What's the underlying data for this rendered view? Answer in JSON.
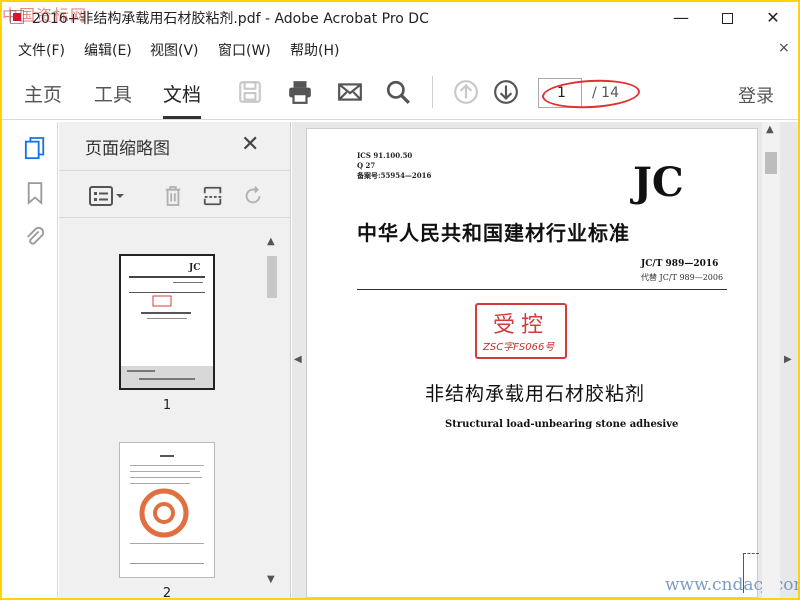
{
  "window": {
    "title": "2016+非结构承载用石材胶粘剂.pdf - Adobe Acrobat Pro DC",
    "min_glyph": "—",
    "close_glyph": "✕"
  },
  "watermark": {
    "top_left": "中国资标网",
    "bottom_right": "www.cndacj.com"
  },
  "menu": {
    "items": [
      "文件(F)",
      "编辑(E)",
      "视图(V)",
      "窗口(W)",
      "帮助(H)"
    ],
    "close_glyph": "×"
  },
  "toolbar": {
    "tabs": [
      "主页",
      "工具",
      "文档"
    ],
    "active_tab": "文档",
    "icons": [
      "save-icon",
      "print-icon",
      "mail-icon",
      "search-icon",
      "prev-page-icon",
      "next-page-icon"
    ],
    "current_page": "1",
    "total_pages": "/ 14",
    "login": "登录",
    "accent_color": "#e03030"
  },
  "left_rail": {
    "icons": [
      "page-thumbnails-icon",
      "bookmark-icon",
      "attachment-icon"
    ]
  },
  "thumbnail_panel": {
    "title": "页面缩略图",
    "close_glyph": "✕",
    "tools": [
      "thumbnail-options-icon",
      "delete-page-icon",
      "insert-page-icon",
      "rotate-page-icon"
    ],
    "pages": [
      {
        "label": "1"
      },
      {
        "label": "2"
      }
    ]
  },
  "document": {
    "ics": "ICS 91.100.50",
    "q": "Q 27",
    "record": "备案号:55954—2016",
    "jc": "JC",
    "standard_title": "中华人民共和国建材行业标准",
    "code": "JC/T 989—2016",
    "replaces": "代替 JC/T 989—2006",
    "stamp_main": "受控",
    "stamp_sub": "ZSC字FS066号",
    "cn_title": "非结构承载用石材胶粘剂",
    "en_title": "Structural load-unbearing stone adhesive"
  }
}
